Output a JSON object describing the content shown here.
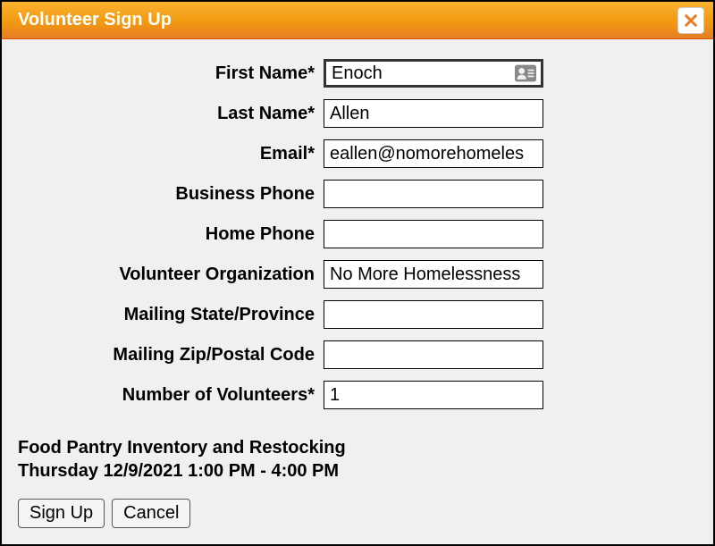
{
  "dialog": {
    "title": "Volunteer Sign Up"
  },
  "form": {
    "first_name": {
      "label": "First Name*",
      "value": "Enoch"
    },
    "last_name": {
      "label": "Last Name*",
      "value": "Allen"
    },
    "email": {
      "label": "Email*",
      "value": "eallen@nomorehomeles"
    },
    "business_phone": {
      "label": "Business Phone",
      "value": ""
    },
    "home_phone": {
      "label": "Home Phone",
      "value": ""
    },
    "volunteer_org": {
      "label": "Volunteer Organization",
      "value": "No More Homelessness"
    },
    "mailing_state": {
      "label": "Mailing State/Province",
      "value": ""
    },
    "mailing_zip": {
      "label": "Mailing Zip/Postal Code",
      "value": ""
    },
    "num_volunteers": {
      "label": "Number of Volunteers*",
      "value": "1"
    }
  },
  "event": {
    "name": "Food Pantry Inventory and Restocking",
    "datetime": "Thursday 12/9/2021 1:00 PM - 4:00 PM"
  },
  "buttons": {
    "signup": "Sign Up",
    "cancel": "Cancel"
  }
}
